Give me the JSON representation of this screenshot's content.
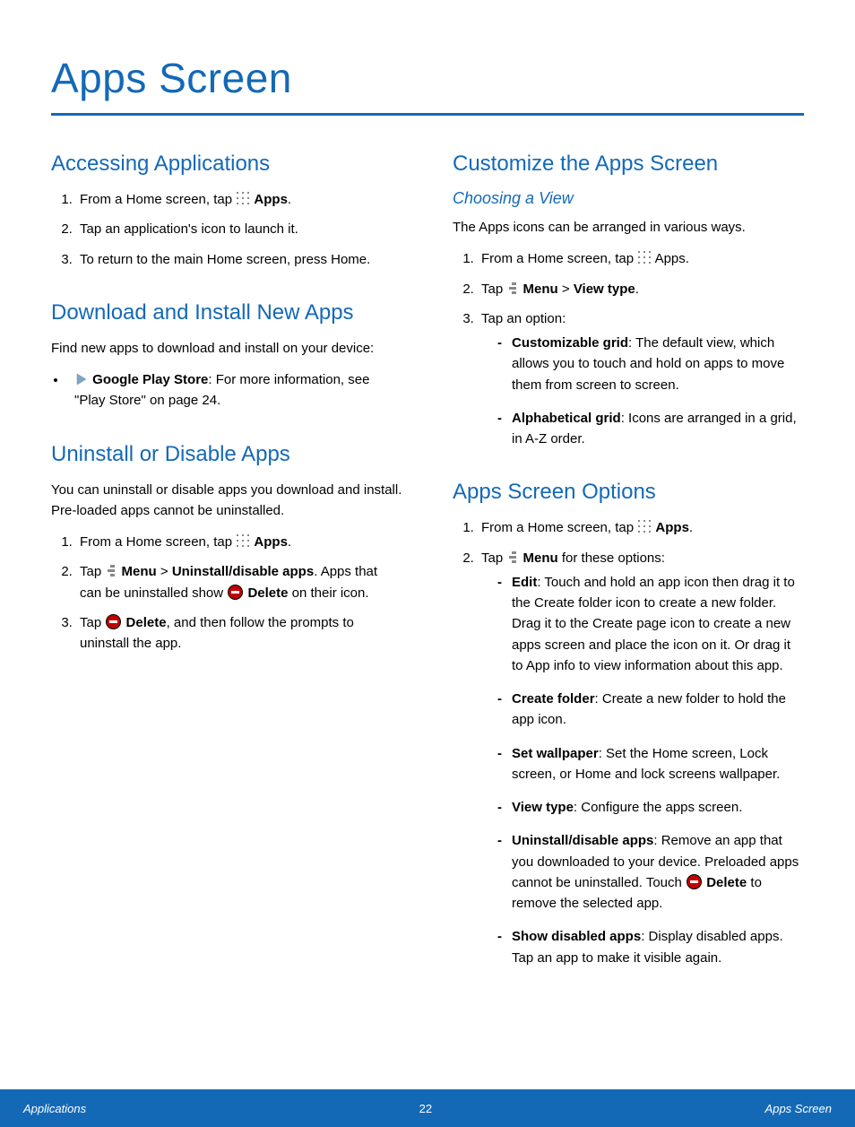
{
  "title": "Apps Screen",
  "left": {
    "s1": {
      "h": "Accessing Applications",
      "i1a": "From a Home screen, tap ",
      "i1b": "Apps",
      "i1c": ".",
      "i2": "Tap an application's icon to launch it.",
      "i3": "To return to the main Home screen, press  Home."
    },
    "s2": {
      "h": "Download and Install New Apps",
      "p": "Find new apps to download and install on your device:",
      "b1a": "Google Play Store",
      "b1b": ": For more information, see \"Play Store\" on page 24."
    },
    "s3": {
      "h": "Uninstall or Disable Apps",
      "p": "You can uninstall or disable apps you download and install. Pre-loaded apps cannot be uninstalled.",
      "i1a": "From a Home screen, tap ",
      "i1b": "Apps",
      "i1c": ".",
      "i2a": "Tap ",
      "i2b": "Menu",
      "i2c": " > ",
      "i2d": "Uninstall/disable apps",
      "i2e": ". Apps that can be uninstalled show ",
      "i2f": "Delete",
      "i2g": " on their icon.",
      "i3a": "Tap ",
      "i3b": "Delete",
      "i3c": ", and then follow the prompts to uninstall the app."
    }
  },
  "right": {
    "s4": {
      "h": "Customize the Apps Screen",
      "sub": "Choosing a View",
      "p": "The Apps icons can be arranged in various ways.",
      "i1a": "From a Home screen, tap ",
      "i1b": " Apps.",
      "i2a": "Tap ",
      "i2b": "Menu",
      "i2c": " > ",
      "i2d": "View type",
      "i2e": ".",
      "i3": "Tap an option:",
      "d1a": "Customizable grid",
      "d1b": ": The default view, which allows you to touch and hold on apps to move them from screen to screen.",
      "d2a": "Alphabetical grid",
      "d2b": ": Icons are arranged in a grid, in A-Z order."
    },
    "s5": {
      "h": "Apps Screen Options",
      "i1a": "From a Home screen, tap ",
      "i1b": "Apps",
      "i1c": ".",
      "i2a": "Tap ",
      "i2b": "Menu",
      "i2c": " for these options:",
      "d1a": "Edit",
      "d1b": ": Touch and hold an app icon then drag it to the Create folder icon to create a new folder. Drag it to the Create page icon to create a new apps screen and place the icon on it. Or drag it to App info to view information about this app.",
      "d2a": "Create folder",
      "d2b": ": Create a new folder to hold the app icon.",
      "d3a": "Set wallpaper",
      "d3b": ": Set the Home screen, Lock screen, or Home and lock screens wallpaper.",
      "d4a": "View type",
      "d4b": ": Configure the apps screen.",
      "d5a": "Uninstall/disable apps",
      "d5b": ": Remove an app that you downloaded to your device. Preloaded apps cannot be uninstalled. Touch ",
      "d5c": "Delete",
      "d5d": " to remove the selected app.",
      "d6a": "Show disabled apps",
      "d6b": ": Display disabled apps. Tap an app to make it visible again."
    }
  },
  "footer": {
    "left": "Applications",
    "page": "22",
    "right": "Apps Screen"
  }
}
